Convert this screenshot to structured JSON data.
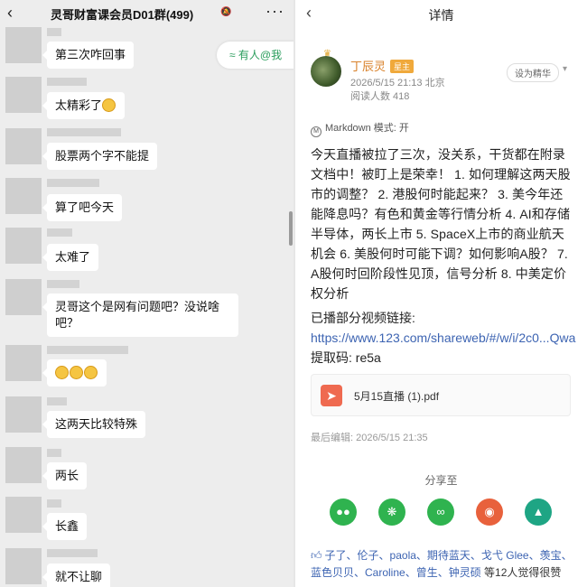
{
  "chat": {
    "title": "灵哥财富课会员D01群(499)",
    "mute_icon": "bell-muted-icon",
    "back_icon": "chevron-left-icon",
    "more_icon": "more-dots-icon",
    "mention_pill": "≈ 有人@我",
    "messages": [
      {
        "text": "第三次咋回事"
      },
      {
        "text": "太精彩了"
      },
      {
        "text": "股票两个字不能提"
      },
      {
        "text": "算了吧今天"
      },
      {
        "text": "太难了"
      },
      {
        "text": "灵哥这个是网有问题吧？没说啥吧？"
      },
      {
        "text": ""
      },
      {
        "text": "这两天比较特殊"
      },
      {
        "text": "两长"
      },
      {
        "text": "长鑫"
      },
      {
        "text": "就不让聊"
      }
    ]
  },
  "detail": {
    "title": "详情",
    "author": {
      "name": "丁辰灵",
      "role": "星主"
    },
    "post_time": "2026/5/15 21:13 北京",
    "read_count": "阅读人数 418",
    "set_featured": "设为精华",
    "markdown_mode": "Markdown 模式: 开",
    "body": "今天直播被拉了三次，没关系，干货都在附录文档中！被盯上是荣幸！ 1. 如何理解这两天股市的调整？ 2. 港股何时能起来？ 3. 美今年还能降息吗？有色和黄金等行情分析 4. AI和存储半导体，两长上市 5. SpaceX上市的商业航天机会 6. 美股何时可能下调？如何影响A股？ 7. A股何时回阶段性见顶，信号分析 8. 中美定价权分析",
    "video_prefix": "已播部分视频链接: ",
    "video_link": "https://www.123.com/shareweb/#/w/i/2c0...Qwa",
    "extract_code": "提取码: re5a",
    "attachment": "5月15直播 (1).pdf",
    "last_edit": "最后编辑: 2026/5/15 21:35",
    "share_label": "分享至",
    "share_buttons": [
      {
        "name": "wechat-icon",
        "color": "#2fb34f"
      },
      {
        "name": "moments-icon",
        "color": "#2fb34f"
      },
      {
        "name": "mini-program-icon",
        "color": "#2fb34f"
      },
      {
        "name": "weibo-icon",
        "color": "#e8613c"
      },
      {
        "name": "gallery-icon",
        "color": "#1ea584"
      }
    ],
    "likes_names": "子了、伦子、paola、期待蓝天、戈弋 Glee、羡宝、蓝色贝贝、Caroline、曾生、钟灵硕",
    "likes_suffix": "等12人觉得很赞"
  }
}
